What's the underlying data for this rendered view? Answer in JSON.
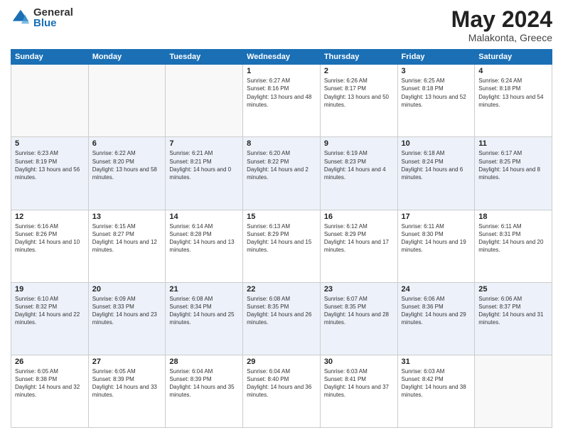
{
  "header": {
    "logo_general": "General",
    "logo_blue": "Blue",
    "title": "May 2024",
    "location": "Malakonta, Greece"
  },
  "weekdays": [
    "Sunday",
    "Monday",
    "Tuesday",
    "Wednesday",
    "Thursday",
    "Friday",
    "Saturday"
  ],
  "weeks": [
    [
      {
        "num": "",
        "sunrise": "",
        "sunset": "",
        "daylight": "",
        "empty": true
      },
      {
        "num": "",
        "sunrise": "",
        "sunset": "",
        "daylight": "",
        "empty": true
      },
      {
        "num": "",
        "sunrise": "",
        "sunset": "",
        "daylight": "",
        "empty": true
      },
      {
        "num": "1",
        "sunrise": "Sunrise: 6:27 AM",
        "sunset": "Sunset: 8:16 PM",
        "daylight": "Daylight: 13 hours and 48 minutes.",
        "empty": false
      },
      {
        "num": "2",
        "sunrise": "Sunrise: 6:26 AM",
        "sunset": "Sunset: 8:17 PM",
        "daylight": "Daylight: 13 hours and 50 minutes.",
        "empty": false
      },
      {
        "num": "3",
        "sunrise": "Sunrise: 6:25 AM",
        "sunset": "Sunset: 8:18 PM",
        "daylight": "Daylight: 13 hours and 52 minutes.",
        "empty": false
      },
      {
        "num": "4",
        "sunrise": "Sunrise: 6:24 AM",
        "sunset": "Sunset: 8:18 PM",
        "daylight": "Daylight: 13 hours and 54 minutes.",
        "empty": false
      }
    ],
    [
      {
        "num": "5",
        "sunrise": "Sunrise: 6:23 AM",
        "sunset": "Sunset: 8:19 PM",
        "daylight": "Daylight: 13 hours and 56 minutes.",
        "empty": false
      },
      {
        "num": "6",
        "sunrise": "Sunrise: 6:22 AM",
        "sunset": "Sunset: 8:20 PM",
        "daylight": "Daylight: 13 hours and 58 minutes.",
        "empty": false
      },
      {
        "num": "7",
        "sunrise": "Sunrise: 6:21 AM",
        "sunset": "Sunset: 8:21 PM",
        "daylight": "Daylight: 14 hours and 0 minutes.",
        "empty": false
      },
      {
        "num": "8",
        "sunrise": "Sunrise: 6:20 AM",
        "sunset": "Sunset: 8:22 PM",
        "daylight": "Daylight: 14 hours and 2 minutes.",
        "empty": false
      },
      {
        "num": "9",
        "sunrise": "Sunrise: 6:19 AM",
        "sunset": "Sunset: 8:23 PM",
        "daylight": "Daylight: 14 hours and 4 minutes.",
        "empty": false
      },
      {
        "num": "10",
        "sunrise": "Sunrise: 6:18 AM",
        "sunset": "Sunset: 8:24 PM",
        "daylight": "Daylight: 14 hours and 6 minutes.",
        "empty": false
      },
      {
        "num": "11",
        "sunrise": "Sunrise: 6:17 AM",
        "sunset": "Sunset: 8:25 PM",
        "daylight": "Daylight: 14 hours and 8 minutes.",
        "empty": false
      }
    ],
    [
      {
        "num": "12",
        "sunrise": "Sunrise: 6:16 AM",
        "sunset": "Sunset: 8:26 PM",
        "daylight": "Daylight: 14 hours and 10 minutes.",
        "empty": false
      },
      {
        "num": "13",
        "sunrise": "Sunrise: 6:15 AM",
        "sunset": "Sunset: 8:27 PM",
        "daylight": "Daylight: 14 hours and 12 minutes.",
        "empty": false
      },
      {
        "num": "14",
        "sunrise": "Sunrise: 6:14 AM",
        "sunset": "Sunset: 8:28 PM",
        "daylight": "Daylight: 14 hours and 13 minutes.",
        "empty": false
      },
      {
        "num": "15",
        "sunrise": "Sunrise: 6:13 AM",
        "sunset": "Sunset: 8:29 PM",
        "daylight": "Daylight: 14 hours and 15 minutes.",
        "empty": false
      },
      {
        "num": "16",
        "sunrise": "Sunrise: 6:12 AM",
        "sunset": "Sunset: 8:29 PM",
        "daylight": "Daylight: 14 hours and 17 minutes.",
        "empty": false
      },
      {
        "num": "17",
        "sunrise": "Sunrise: 6:11 AM",
        "sunset": "Sunset: 8:30 PM",
        "daylight": "Daylight: 14 hours and 19 minutes.",
        "empty": false
      },
      {
        "num": "18",
        "sunrise": "Sunrise: 6:11 AM",
        "sunset": "Sunset: 8:31 PM",
        "daylight": "Daylight: 14 hours and 20 minutes.",
        "empty": false
      }
    ],
    [
      {
        "num": "19",
        "sunrise": "Sunrise: 6:10 AM",
        "sunset": "Sunset: 8:32 PM",
        "daylight": "Daylight: 14 hours and 22 minutes.",
        "empty": false
      },
      {
        "num": "20",
        "sunrise": "Sunrise: 6:09 AM",
        "sunset": "Sunset: 8:33 PM",
        "daylight": "Daylight: 14 hours and 23 minutes.",
        "empty": false
      },
      {
        "num": "21",
        "sunrise": "Sunrise: 6:08 AM",
        "sunset": "Sunset: 8:34 PM",
        "daylight": "Daylight: 14 hours and 25 minutes.",
        "empty": false
      },
      {
        "num": "22",
        "sunrise": "Sunrise: 6:08 AM",
        "sunset": "Sunset: 8:35 PM",
        "daylight": "Daylight: 14 hours and 26 minutes.",
        "empty": false
      },
      {
        "num": "23",
        "sunrise": "Sunrise: 6:07 AM",
        "sunset": "Sunset: 8:35 PM",
        "daylight": "Daylight: 14 hours and 28 minutes.",
        "empty": false
      },
      {
        "num": "24",
        "sunrise": "Sunrise: 6:06 AM",
        "sunset": "Sunset: 8:36 PM",
        "daylight": "Daylight: 14 hours and 29 minutes.",
        "empty": false
      },
      {
        "num": "25",
        "sunrise": "Sunrise: 6:06 AM",
        "sunset": "Sunset: 8:37 PM",
        "daylight": "Daylight: 14 hours and 31 minutes.",
        "empty": false
      }
    ],
    [
      {
        "num": "26",
        "sunrise": "Sunrise: 6:05 AM",
        "sunset": "Sunset: 8:38 PM",
        "daylight": "Daylight: 14 hours and 32 minutes.",
        "empty": false
      },
      {
        "num": "27",
        "sunrise": "Sunrise: 6:05 AM",
        "sunset": "Sunset: 8:39 PM",
        "daylight": "Daylight: 14 hours and 33 minutes.",
        "empty": false
      },
      {
        "num": "28",
        "sunrise": "Sunrise: 6:04 AM",
        "sunset": "Sunset: 8:39 PM",
        "daylight": "Daylight: 14 hours and 35 minutes.",
        "empty": false
      },
      {
        "num": "29",
        "sunrise": "Sunrise: 6:04 AM",
        "sunset": "Sunset: 8:40 PM",
        "daylight": "Daylight: 14 hours and 36 minutes.",
        "empty": false
      },
      {
        "num": "30",
        "sunrise": "Sunrise: 6:03 AM",
        "sunset": "Sunset: 8:41 PM",
        "daylight": "Daylight: 14 hours and 37 minutes.",
        "empty": false
      },
      {
        "num": "31",
        "sunrise": "Sunrise: 6:03 AM",
        "sunset": "Sunset: 8:42 PM",
        "daylight": "Daylight: 14 hours and 38 minutes.",
        "empty": false
      },
      {
        "num": "",
        "sunrise": "",
        "sunset": "",
        "daylight": "",
        "empty": true
      }
    ]
  ]
}
